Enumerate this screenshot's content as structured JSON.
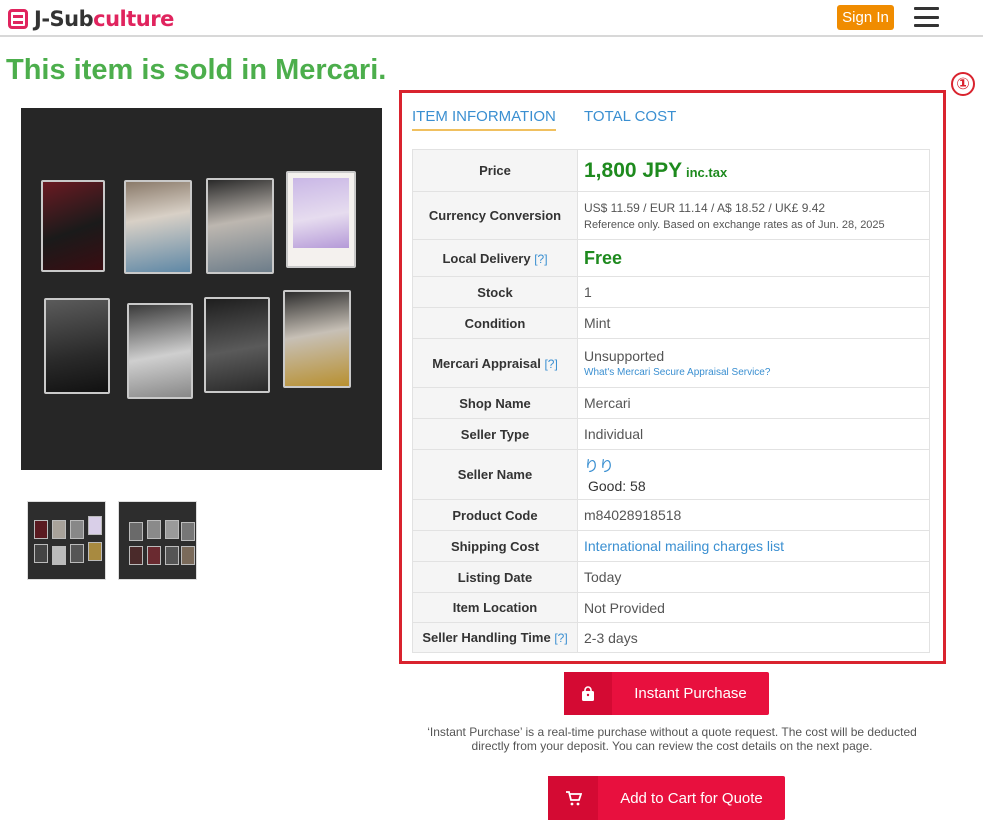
{
  "header": {
    "logo_prefix": "J-Sub",
    "logo_accent": "culture",
    "signin_label": "Sign In"
  },
  "page_title": "This item is sold in Mercari.",
  "annotation_number": "①",
  "tabs": [
    {
      "label": "ITEM INFORMATION",
      "active": true
    },
    {
      "label": "TOTAL COST",
      "active": false
    }
  ],
  "info": {
    "price": {
      "label": "Price",
      "amount": "1,800 JPY",
      "tax": "inc.tax"
    },
    "currency": {
      "label": "Currency Conversion",
      "line": "US$ 11.59 /  EUR 11.14 /  A$ 18.52 /  UK£  9.42",
      "note": "Reference only. Based on exchange rates as of Jun. 28, 2025"
    },
    "local_delivery": {
      "label": "Local Delivery",
      "help": "[?]",
      "value": "Free"
    },
    "stock": {
      "label": "Stock",
      "value": "1"
    },
    "condition": {
      "label": "Condition",
      "value": "Mint"
    },
    "appraisal": {
      "label": "Mercari Appraisal",
      "help": "[?]",
      "value": "Unsupported",
      "link": "What's Mercari Secure Appraisal Service?"
    },
    "shop_name": {
      "label": "Shop Name",
      "value": "Mercari"
    },
    "seller_type": {
      "label": "Seller Type",
      "value": "Individual"
    },
    "seller_name": {
      "label": "Seller Name",
      "value": "りり",
      "good_label": "Good:",
      "good_count": "58"
    },
    "product_code": {
      "label": "Product Code",
      "value": "m84028918518"
    },
    "shipping_cost": {
      "label": "Shipping Cost",
      "value": "International mailing charges list"
    },
    "listing_date": {
      "label": "Listing Date",
      "value": "Today"
    },
    "item_location": {
      "label": "Item Location",
      "value": "Not Provided"
    },
    "handling_time": {
      "label": "Seller Handling Time",
      "help": "[?]",
      "value": "2-3 days"
    }
  },
  "buttons": {
    "instant_purchase": "Instant Purchase",
    "add_to_cart": "Add to Cart for Quote"
  },
  "instant_note": "‘Instant Purchase’ is a real-time purchase without a quote request. The cost will be deducted directly from your deposit. You can review the cost details on the next page.",
  "colors": {
    "accent_red": "#e8103e",
    "sold_green": "#4cae4c",
    "price_green": "#1e8a1e",
    "link_blue": "#3a8fd1",
    "signin_orange": "#f08c00",
    "frame_red": "#d9232e"
  },
  "icons": [
    "logo-icon",
    "menu-icon",
    "shopping-bag-icon",
    "cart-icon"
  ]
}
